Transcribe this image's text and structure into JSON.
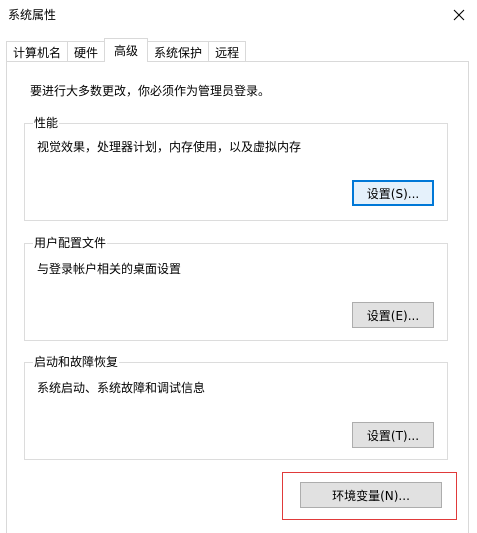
{
  "window": {
    "title": "系统属性",
    "close_symbol": "✕"
  },
  "tabs": [
    {
      "label": "计算机名",
      "active": false
    },
    {
      "label": "硬件",
      "active": false
    },
    {
      "label": "高级",
      "active": true
    },
    {
      "label": "系统保护",
      "active": false
    },
    {
      "label": "远程",
      "active": false
    }
  ],
  "advanced": {
    "intro": "要进行大多数更改，你必须作为管理员登录。",
    "performance": {
      "legend": "性能",
      "description": "视觉效果，处理器计划，内存使用，以及虚拟内存",
      "button": "设置(S)..."
    },
    "user_profiles": {
      "legend": "用户配置文件",
      "description": "与登录帐户相关的桌面设置",
      "button": "设置(E)..."
    },
    "startup_recovery": {
      "legend": "启动和故障恢复",
      "description": "系统启动、系统故障和调试信息",
      "button": "设置(T)..."
    },
    "env_button": "环境变量(N)..."
  },
  "colors": {
    "focus_border": "#0078d7",
    "highlight_box": "#e03a3a"
  }
}
